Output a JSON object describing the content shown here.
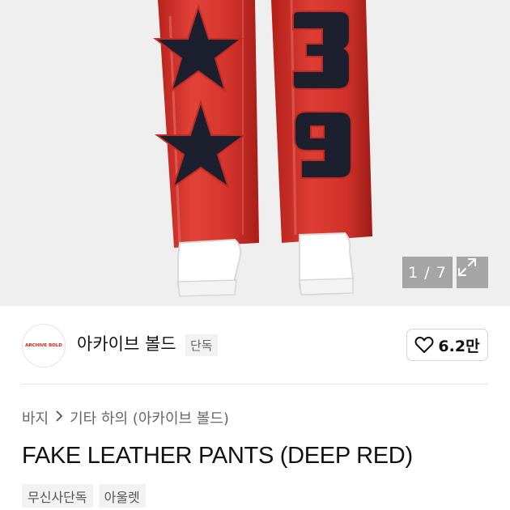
{
  "gallery": {
    "current": "1",
    "total": "7",
    "counter_text": "1 / 7",
    "expand_icon": "expand-arrows-icon"
  },
  "brand": {
    "logo_text": "ARCHIVE BOLD",
    "name": "아카이브 볼드",
    "exclusive_tag": "단독"
  },
  "like": {
    "icon": "heart-icon",
    "count": "6.2만"
  },
  "breadcrumb": {
    "level1": "바지",
    "level2": "기타 하의 (아카이브 볼드)"
  },
  "product": {
    "title": "FAKE LEATHER PANTS (DEEP RED)"
  },
  "tags": [
    "무신사단독",
    "아울렛"
  ],
  "colors": {
    "pants_red": "#d7372f",
    "patch_navy": "#1b1f2e",
    "brand_red": "#e0231b"
  }
}
